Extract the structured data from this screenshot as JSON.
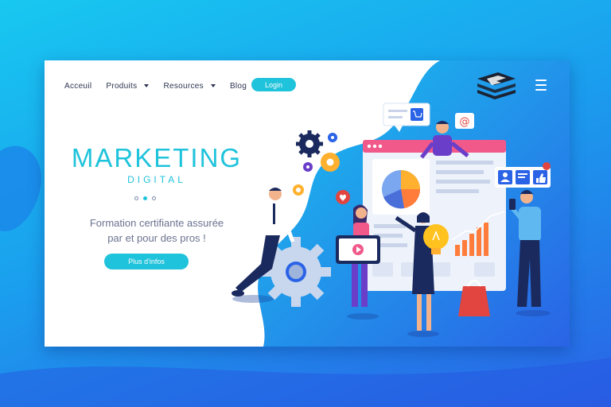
{
  "nav": {
    "items": [
      {
        "label": "Acceuil",
        "has_dropdown": false
      },
      {
        "label": "Produits",
        "has_dropdown": true
      },
      {
        "label": "Resources",
        "has_dropdown": true
      },
      {
        "label": "Blog",
        "has_dropdown": false
      }
    ],
    "login_label": "Login"
  },
  "hero": {
    "title": "MARKETING",
    "subtitle": "DIGITAL",
    "description_line1": "Formation certifiante  assurée",
    "description_line2": "par et pour des pros !",
    "cta_label": "Plus d'infos",
    "slider": {
      "count": 3,
      "active_index": 1
    }
  },
  "icons": [
    "menu-icon",
    "logo-icon",
    "cart-icon",
    "email-icon",
    "heart-icon",
    "user-icon",
    "chat-icon",
    "thumbs-up-icon",
    "gear-icon",
    "lightbulb-icon",
    "video-icon",
    "shopping-bag-icon",
    "pie-chart-icon"
  ],
  "colors": {
    "accent": "#1fc3db",
    "background_top": "#18c8f0",
    "background_bottom": "#2a63e6",
    "page": "#ffffff",
    "text": "#2c3550"
  }
}
